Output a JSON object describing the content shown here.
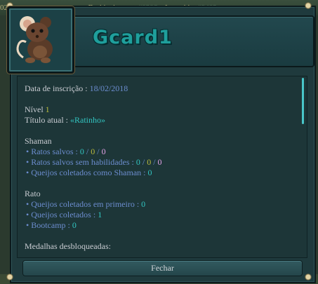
{
  "background": {
    "ticker_left": "023",
    "ticker_text": "mes : Darkizgingon",
    "ticker_code": "#0306",
    "ticker_text2": "Itaozahi",
    "ticker_code2": "#9402"
  },
  "profile": {
    "name": "Gcard1",
    "avatar_icon": "mouse-avatar-icon"
  },
  "details": {
    "registration_label": "Data de inscrição : ",
    "registration_date": "18/02/2018",
    "level_label": "Nível ",
    "level_value": "1",
    "title_label": "Título atual : ",
    "title_value": "«Ratinho»",
    "shaman": {
      "heading": "Shaman",
      "saved_label": "• Ratos salvos : ",
      "saved_values": [
        "0",
        "0",
        "0"
      ],
      "saved_noskill_label": "• Ratos salvos sem habilidades : ",
      "saved_noskill_values": [
        "0",
        "0",
        "0"
      ],
      "cheese_label": "• Queijos coletados como Shaman : ",
      "cheese_value": "0",
      "separator": " / "
    },
    "mouse": {
      "heading": "Rato",
      "first_label": "• Queijos coletados em primeiro : ",
      "first_value": "0",
      "collected_label": "• Queijos coletados : ",
      "collected_value": "1",
      "bootcamp_label": "• Bootcamp : ",
      "bootcamp_value": "0"
    },
    "medals_label": "Medalhas desbloqueadas:"
  },
  "close_label": "Fechar",
  "colors": {
    "date": "#6c8dcf",
    "level": "#bbbc3e",
    "title": "#32c6c2",
    "pink": "#e5a3e8",
    "name": "#1f9f9c"
  }
}
